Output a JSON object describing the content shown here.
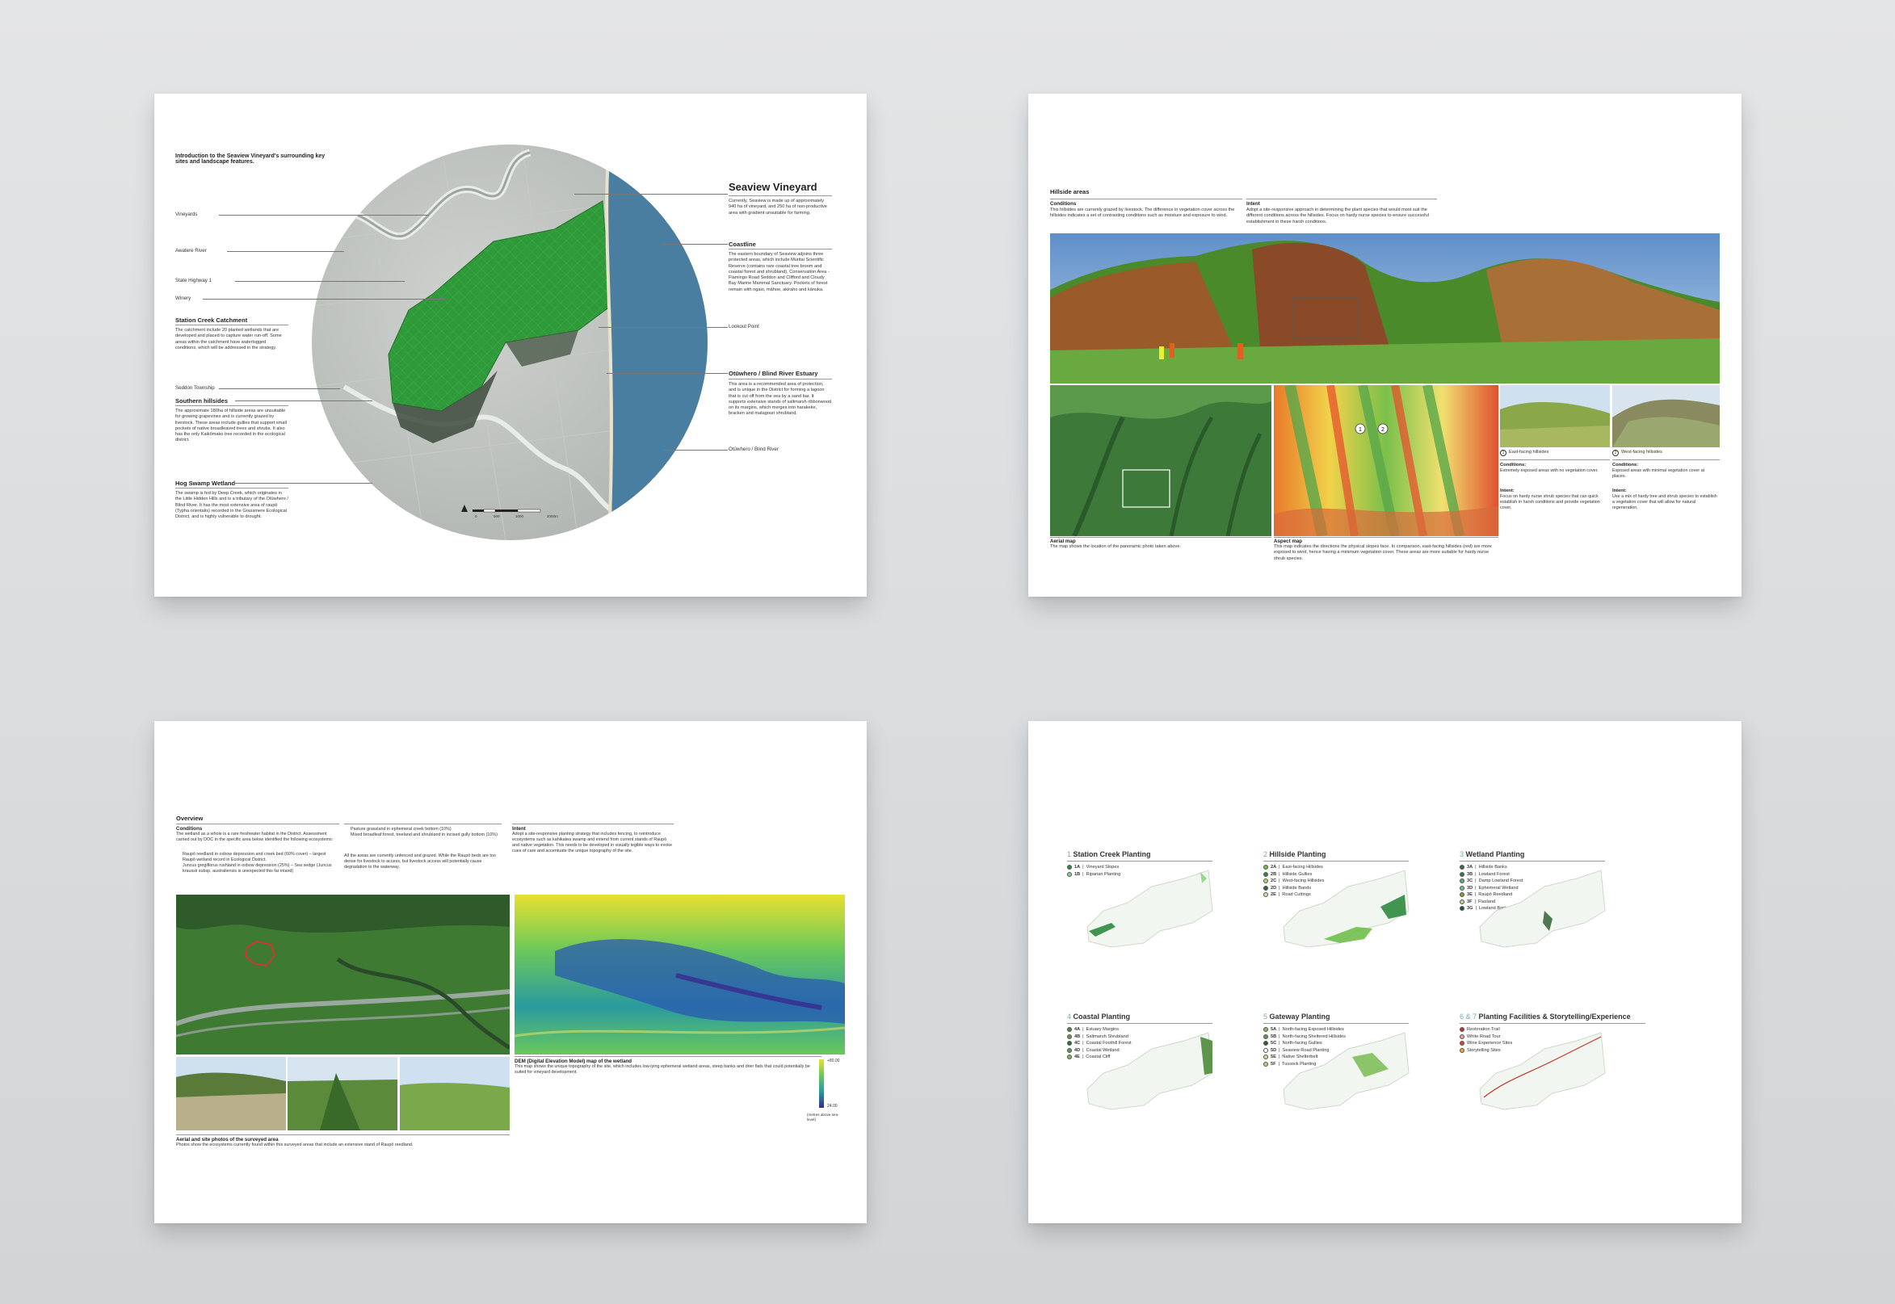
{
  "sheet1": {
    "intro": "Introduction to the Seaview Vineyard's surrounding key sites and landscape features.",
    "left_labels": [
      "Vineyards",
      "Awatere River",
      "State Highway 1",
      "Winery"
    ],
    "station_title": "Station Creek Catchment",
    "station_text": "The catchment include 20 planted wetlands that are developed and placed to capture water run-off. Some areas within the catchment have waterlogged conditions, which will be addressed in the strategy.",
    "seddon_label": "Seddon Township",
    "southern_title": "Southern hillsides",
    "southern_text": "The approximate 180ha of hillside areas are unsuitable for growing grapevines and is currently grazed by livestock. These areas include gullies that support small pockets of native broadleaved trees and shrubs. It also has the only Kaikōmako tree recorded in the ecological district.",
    "hog_title": "Hog Swamp Wetland",
    "hog_text": "The swamp is fed by Deep Creek, which originates in the Little Hidden Hills and is a tributary of the Otūwhero / Blind River. It has the most extensive area of raupō (Typha orientalis) recorded in the Grassmere Ecological District, and is highly vulnerable to drought.",
    "seaview_title": "Seaview Vineyard",
    "seaview_text": "Currently, Seaview is made up of approximately 940 ha of vineyard, and 250 ha of non-productive area with gradient unsuitable for farming.",
    "coast_title": "Coastline",
    "coast_text": "The eastern boundary of Seaview adjoins three protected areas, which include Muritai Scientific Reserve (contains rare coastal tree broom and coastal forest and shrubland), Conservation Area - Flamingo Road Seddon and Clifford and Cloudy Bay Marine Mammal Sanctuary. Pockets of forest remain with ngaio, māhoe, akiraho and kānuka.",
    "lookout_label": "Lookout Point",
    "estuary_title": "Otūwhero / Blind River Estuary",
    "estuary_text": "This area is a recommended area of protection, and is unique in the District for forming a lagoon that is cut off from the sea by a sand bar. It supports extensive stands of saltmarsh ribbonwood on its margins, which merges into harakeke, bracken and matagouri shrubland.",
    "blind_label": "Otūwhero / Blind River",
    "scale_labels": [
      "0",
      "500",
      "1000",
      "2000m"
    ]
  },
  "sheet2": {
    "title": "Hillside areas",
    "cond_title": "Conditions",
    "cond_text": "This hillsides are currently grazed by livestock. The difference in vegetation cover across the hillsides indicates a set of contrasting conditions such as moisture and exposure to wind.",
    "intent_title": "Intent",
    "intent_text": "Adopt a site-responsive approach in determining the plant species that would most suit the different conditions across the hillsides. Focus on hardy nurse species to ensure successful establishment in these harsh conditions.",
    "aerial_title": "Aerial map",
    "aerial_text": "The map shows the location of the panoramic photo taken above.",
    "aspect_title": "Aspect map",
    "aspect_text": "This map indicates the directions the physical slopes face. In comparison, east-facing hillsides (red) are more exposed to wind, hence having a minimum vegetation cover. These areas are more suitable for hardy nurse shrub species.",
    "east_label": "East-facing hillsides",
    "west_label": "West-facing hillsides",
    "east_cond_title": "Conditions:",
    "east_cond_text": "Extremely exposed areas with no vegetation cover.",
    "east_intent_title": "Intent:",
    "east_intent_text": "Focus on hardy nurse shrub species that can quick establish in harsh conditions and provide vegetation cover.",
    "west_cond_title": "Conditions:",
    "west_cond_text": "Exposed areas with minimal vegetation cover at places.",
    "west_intent_title": "Intent:",
    "west_intent_text": "Use a mix of hardy tree and shrub species to establish a vegetation cover that will allow for natural regeneration.",
    "marker1": "1",
    "marker2": "2"
  },
  "sheet3": {
    "title": "Overview",
    "cond_title": "Conditions",
    "cond_text": "The wetland as a whole is a rare freshwater habitat in the District. Assessment carried out by DOC in the specific area below identified the following ecosystems:",
    "cond_bullets": [
      "Raupō reedland in oxbow depression and creek bed (60% cover) – largest Raupō wetland record in Ecological District.",
      "Juncus gregiflorus rushland in oxbow depression (25%) – Sea sedge (Juncus kraussii subsp. australiensis is unexpected this far inland)"
    ],
    "mid_bullets": [
      "Pasture grassland in ephemeral creek bottom (10%)",
      "Mixed broadleaf forest, treeland and shrubland in incised gully bottom (10%)"
    ],
    "mid_text": "All the areas are currently unfenced and grazed. While the Raupō beds are too dense for livestock to access, but livestock access will potentially cause degradation to the waterway.",
    "intent_title": "Intent",
    "intent_text": "Adopt a site-responsive planting strategy that includes fencing, to reintroduce ecosystems such as kahikatea swamp and extend from current stands of Raupō and native vegetation. This needs to be developed in visually legible ways to evoke cues of care and accentuate the unique topography of the site.",
    "photos_title": "Aerial and site photos of the surveyed area",
    "photos_text": "Photos show the ecosystems currently found within this surveyed areas that include an extensive stand of Raupō reedland.",
    "dem_title": "DEM (Digital Elevation Model) map of the wetland",
    "dem_text": "This map shows the unique topography of the site, which includes low-lying ephemeral wetland areas, steep banks and drier flats that could potentially be suited for vineyard development.",
    "scale_top": "+80.00",
    "scale_bottom": "24.00",
    "scale_unit": "(metres above sea-level)"
  },
  "sheet4": {
    "plans": [
      {
        "num": "1",
        "title": "Station Creek Planting",
        "items": [
          {
            "code": "1A",
            "label": "Vineyard Slopes",
            "color": "#2e8b3e"
          },
          {
            "code": "1B",
            "label": "Riparian Planting",
            "color": "#8fd18a"
          }
        ]
      },
      {
        "num": "2",
        "title": "Hillside Planting",
        "items": [
          {
            "code": "2A",
            "label": "East-facing Hillsides",
            "color": "#6fbf4a"
          },
          {
            "code": "2B",
            "label": "Hillside Gullies",
            "color": "#2e8b3e"
          },
          {
            "code": "2C",
            "label": "West-facing Hillsides",
            "color": "#a6d96a"
          },
          {
            "code": "2D",
            "label": "Hillside Bands",
            "color": "#1f6f34"
          },
          {
            "code": "2E",
            "label": "Road Cuttings",
            "color": "#c8e6a0"
          }
        ]
      },
      {
        "num": "3",
        "title": "Wetland Planting",
        "items": [
          {
            "code": "3A",
            "label": "Hillside Banks",
            "color": "#3d6b3d"
          },
          {
            "code": "3B",
            "label": "Lowland Forest",
            "color": "#2e7d4a"
          },
          {
            "code": "3C",
            "label": "Damp Lowland Forest",
            "color": "#4caf7a"
          },
          {
            "code": "3D",
            "label": "Ephemeral Wetland",
            "color": "#6bbf8a"
          },
          {
            "code": "3E",
            "label": "Raupō Reedland",
            "color": "#8a9a3a"
          },
          {
            "code": "3F",
            "label": "Flaxland",
            "color": "#b8d88a"
          },
          {
            "code": "3G",
            "label": "Lowland Banks",
            "color": "#1e5a35"
          }
        ]
      },
      {
        "num": "4",
        "title": "Coastal Planting",
        "items": [
          {
            "code": "4A",
            "label": "Estuary Margins",
            "color": "#4e8a3a"
          },
          {
            "code": "4B",
            "label": "Saltmarsh Shrubland",
            "color": "#6a9a4a"
          },
          {
            "code": "4C",
            "label": "Coastal Foothill Forest",
            "color": "#2f6f3a"
          },
          {
            "code": "4D",
            "label": "Coastal Wetland",
            "color": "#5aa05a"
          },
          {
            "code": "4E",
            "label": "Coastal Cliff",
            "color": "#8ab05a"
          }
        ]
      },
      {
        "num": "5",
        "title": "Gateway Planting",
        "items": [
          {
            "code": "5A",
            "label": "North-facing Exposed Hillsides",
            "color": "#7fbf5a"
          },
          {
            "code": "5B",
            "label": "North-facing Sheltered Hillsides",
            "color": "#5a9a4a"
          },
          {
            "code": "5C",
            "label": "North-facing Gullies",
            "color": "#2f5f2f"
          },
          {
            "code": "5D",
            "label": "Seaview Road Planting",
            "color": "#ffffff"
          },
          {
            "code": "5E",
            "label": "Native Shelterbelt",
            "color": "#c8d8a0"
          },
          {
            "code": "5F",
            "label": "Tussock Planting",
            "color": "#d8c070"
          }
        ]
      },
      {
        "num": "6 & 7",
        "title": "Planting Facilities & Storytelling/Experience",
        "items": [
          {
            "code": "",
            "label": "Restoration Trail",
            "color": "#c0392b"
          },
          {
            "code": "",
            "label": "White Road Tour",
            "color": "#e6a0a0"
          },
          {
            "code": "",
            "label": "Wine Experience Sites",
            "color": "#e04030"
          },
          {
            "code": "",
            "label": "Storytelling Sites",
            "color": "#f0a030"
          }
        ]
      }
    ]
  },
  "colors": {
    "sea": "#4a7ea0",
    "vineyard": "#2f9a3a",
    "map_bg": "#f2f6f0"
  }
}
